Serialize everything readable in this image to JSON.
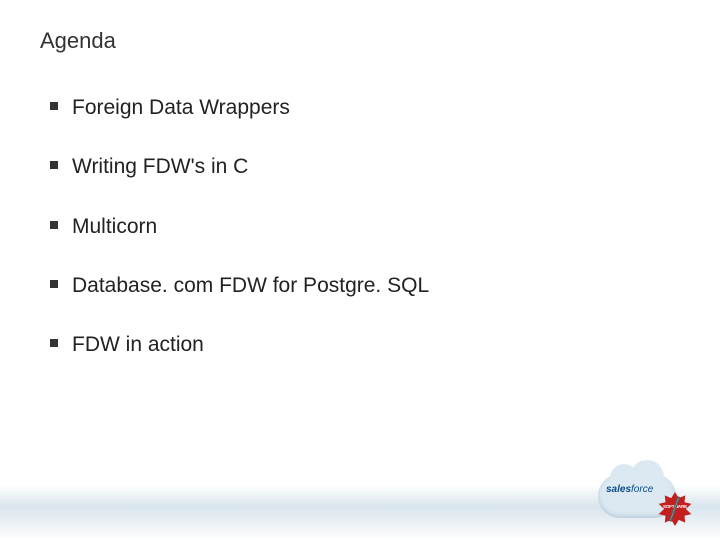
{
  "title": "Agenda",
  "bullets": [
    {
      "text": "Foreign Data Wrappers"
    },
    {
      "text": "Writing FDW's in C"
    },
    {
      "text": "Multicorn"
    },
    {
      "text": "Database. com FDW for Postgre. SQL"
    },
    {
      "text": "FDW in action"
    }
  ],
  "logo": {
    "brand_primary": "sales",
    "brand_secondary": "force",
    "badge_text": "SOFTWARE"
  }
}
